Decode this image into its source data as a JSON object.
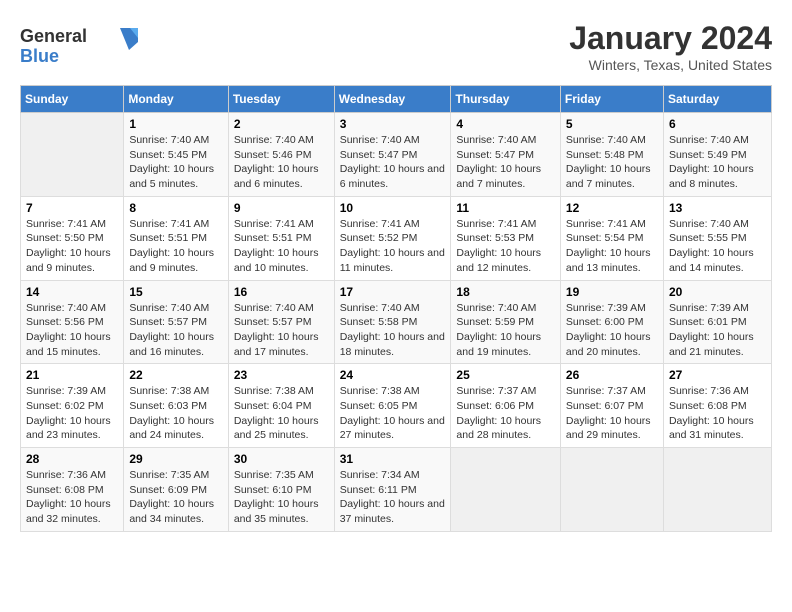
{
  "header": {
    "logo_general": "General",
    "logo_blue": "Blue",
    "title": "January 2024",
    "subtitle": "Winters, Texas, United States"
  },
  "calendar": {
    "days_of_week": [
      "Sunday",
      "Monday",
      "Tuesday",
      "Wednesday",
      "Thursday",
      "Friday",
      "Saturday"
    ],
    "weeks": [
      [
        {
          "day": "",
          "empty": true
        },
        {
          "day": "1",
          "sunrise": "7:40 AM",
          "sunset": "5:45 PM",
          "daylight": "10 hours and 5 minutes."
        },
        {
          "day": "2",
          "sunrise": "7:40 AM",
          "sunset": "5:46 PM",
          "daylight": "10 hours and 6 minutes."
        },
        {
          "day": "3",
          "sunrise": "7:40 AM",
          "sunset": "5:47 PM",
          "daylight": "10 hours and 6 minutes."
        },
        {
          "day": "4",
          "sunrise": "7:40 AM",
          "sunset": "5:47 PM",
          "daylight": "10 hours and 7 minutes."
        },
        {
          "day": "5",
          "sunrise": "7:40 AM",
          "sunset": "5:48 PM",
          "daylight": "10 hours and 7 minutes."
        },
        {
          "day": "6",
          "sunrise": "7:40 AM",
          "sunset": "5:49 PM",
          "daylight": "10 hours and 8 minutes."
        }
      ],
      [
        {
          "day": "7",
          "sunrise": "7:41 AM",
          "sunset": "5:50 PM",
          "daylight": "10 hours and 9 minutes."
        },
        {
          "day": "8",
          "sunrise": "7:41 AM",
          "sunset": "5:51 PM",
          "daylight": "10 hours and 9 minutes."
        },
        {
          "day": "9",
          "sunrise": "7:41 AM",
          "sunset": "5:51 PM",
          "daylight": "10 hours and 10 minutes."
        },
        {
          "day": "10",
          "sunrise": "7:41 AM",
          "sunset": "5:52 PM",
          "daylight": "10 hours and 11 minutes."
        },
        {
          "day": "11",
          "sunrise": "7:41 AM",
          "sunset": "5:53 PM",
          "daylight": "10 hours and 12 minutes."
        },
        {
          "day": "12",
          "sunrise": "7:41 AM",
          "sunset": "5:54 PM",
          "daylight": "10 hours and 13 minutes."
        },
        {
          "day": "13",
          "sunrise": "7:40 AM",
          "sunset": "5:55 PM",
          "daylight": "10 hours and 14 minutes."
        }
      ],
      [
        {
          "day": "14",
          "sunrise": "7:40 AM",
          "sunset": "5:56 PM",
          "daylight": "10 hours and 15 minutes."
        },
        {
          "day": "15",
          "sunrise": "7:40 AM",
          "sunset": "5:57 PM",
          "daylight": "10 hours and 16 minutes."
        },
        {
          "day": "16",
          "sunrise": "7:40 AM",
          "sunset": "5:57 PM",
          "daylight": "10 hours and 17 minutes."
        },
        {
          "day": "17",
          "sunrise": "7:40 AM",
          "sunset": "5:58 PM",
          "daylight": "10 hours and 18 minutes."
        },
        {
          "day": "18",
          "sunrise": "7:40 AM",
          "sunset": "5:59 PM",
          "daylight": "10 hours and 19 minutes."
        },
        {
          "day": "19",
          "sunrise": "7:39 AM",
          "sunset": "6:00 PM",
          "daylight": "10 hours and 20 minutes."
        },
        {
          "day": "20",
          "sunrise": "7:39 AM",
          "sunset": "6:01 PM",
          "daylight": "10 hours and 21 minutes."
        }
      ],
      [
        {
          "day": "21",
          "sunrise": "7:39 AM",
          "sunset": "6:02 PM",
          "daylight": "10 hours and 23 minutes."
        },
        {
          "day": "22",
          "sunrise": "7:38 AM",
          "sunset": "6:03 PM",
          "daylight": "10 hours and 24 minutes."
        },
        {
          "day": "23",
          "sunrise": "7:38 AM",
          "sunset": "6:04 PM",
          "daylight": "10 hours and 25 minutes."
        },
        {
          "day": "24",
          "sunrise": "7:38 AM",
          "sunset": "6:05 PM",
          "daylight": "10 hours and 27 minutes."
        },
        {
          "day": "25",
          "sunrise": "7:37 AM",
          "sunset": "6:06 PM",
          "daylight": "10 hours and 28 minutes."
        },
        {
          "day": "26",
          "sunrise": "7:37 AM",
          "sunset": "6:07 PM",
          "daylight": "10 hours and 29 minutes."
        },
        {
          "day": "27",
          "sunrise": "7:36 AM",
          "sunset": "6:08 PM",
          "daylight": "10 hours and 31 minutes."
        }
      ],
      [
        {
          "day": "28",
          "sunrise": "7:36 AM",
          "sunset": "6:08 PM",
          "daylight": "10 hours and 32 minutes."
        },
        {
          "day": "29",
          "sunrise": "7:35 AM",
          "sunset": "6:09 PM",
          "daylight": "10 hours and 34 minutes."
        },
        {
          "day": "30",
          "sunrise": "7:35 AM",
          "sunset": "6:10 PM",
          "daylight": "10 hours and 35 minutes."
        },
        {
          "day": "31",
          "sunrise": "7:34 AM",
          "sunset": "6:11 PM",
          "daylight": "10 hours and 37 minutes."
        },
        {
          "day": "",
          "empty": true
        },
        {
          "day": "",
          "empty": true
        },
        {
          "day": "",
          "empty": true
        }
      ]
    ],
    "labels": {
      "sunrise": "Sunrise:",
      "sunset": "Sunset:",
      "daylight": "Daylight:"
    }
  }
}
